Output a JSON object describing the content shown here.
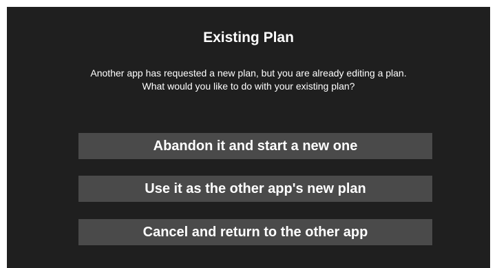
{
  "dialog": {
    "title": "Existing Plan",
    "message_line1": "Another app has requested a new plan, but you are already editing a plan.",
    "message_line2": "What would you like to do with your existing plan?",
    "buttons": [
      {
        "label": "Abandon it and start a new one"
      },
      {
        "label": "Use it as the other app's new plan"
      },
      {
        "label": "Cancel and return to the other app"
      }
    ],
    "colors": {
      "background": "#1f1f1f",
      "button": "#4a4a4a",
      "text": "#ffffff"
    }
  }
}
